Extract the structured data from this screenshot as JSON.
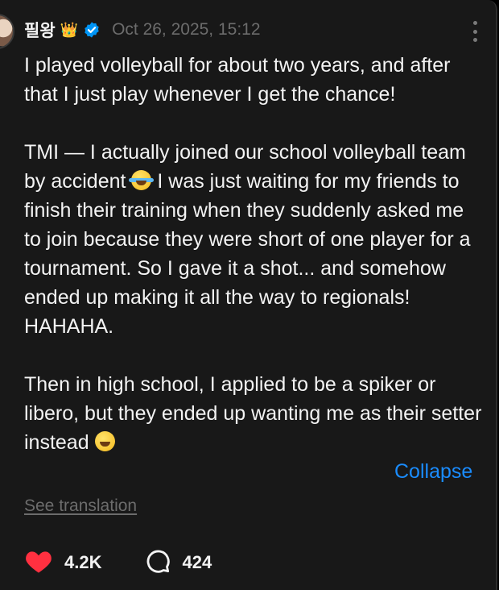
{
  "post": {
    "username": "필왕",
    "badge_emoji": "👑",
    "timestamp": "Oct 26, 2025, 15:12",
    "paragraph1": "I played volleyball for about two years, and after that I just play whenever I get the chance!",
    "paragraph2_part1": "TMI — I actually joined our school volleyball team by accident ",
    "paragraph2_part2": " I was just waiting for my friends to finish their training when they suddenly asked me to join because they were short of one player for a tournament. So I gave it a shot... and somehow ended up making it all the way to regionals! HAHAHA.",
    "paragraph3": "Then in high school, I applied to be a spiker or libero, but they ended up wanting me as their setter instead ",
    "collapse_label": "Collapse",
    "translation_label": "See translation",
    "likes": "4.2K",
    "replies": "424"
  },
  "icons": [
    "verified-icon",
    "more-icon",
    "heart-icon",
    "reply-icon",
    "tears-of-joy-emoji",
    "grinning-squint-emoji",
    "crown-emoji"
  ],
  "colors": {
    "background": "#181818",
    "text": "#f3f3f3",
    "muted": "#6c6c6c",
    "link": "#1a8cff",
    "like": "#ff3040",
    "verified": "#0095f6"
  }
}
